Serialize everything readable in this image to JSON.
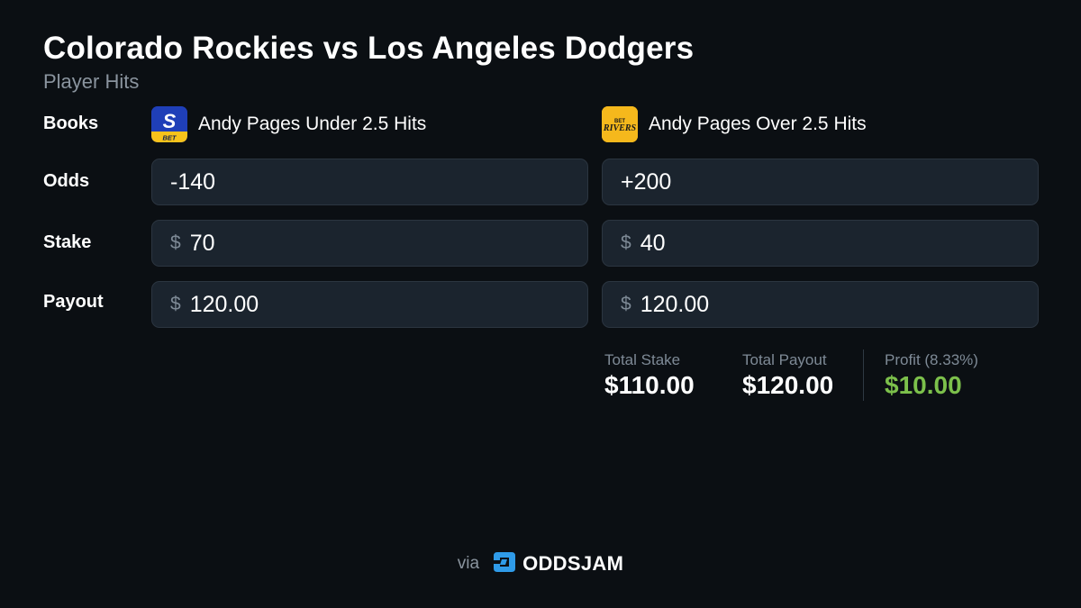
{
  "header": {
    "title": "Colorado Rockies vs Los Angeles Dodgers",
    "subtitle": "Player Hits"
  },
  "row_labels": {
    "books": "Books",
    "odds": "Odds",
    "stake": "Stake",
    "payout": "Payout"
  },
  "currency_symbol": "$",
  "bets": [
    {
      "book_logo": "thescore-bet-logo",
      "book_logo_text": "BET",
      "logo_letter": "S",
      "market": "Andy Pages Under 2.5 Hits",
      "odds": "-140",
      "stake": "70",
      "payout": "120.00"
    },
    {
      "book_logo": "betrivers-logo",
      "book_logo_text_top": "BET",
      "book_logo_text_bottom": "RIVERS",
      "market": "Andy Pages Over 2.5 Hits",
      "odds": "+200",
      "stake": "40",
      "payout": "120.00"
    }
  ],
  "summary": {
    "total_stake_label": "Total Stake",
    "total_stake": "$110.00",
    "total_payout_label": "Total Payout",
    "total_payout": "$120.00",
    "profit_label": "Profit (8.33%)",
    "profit": "$10.00"
  },
  "footer": {
    "via": "via",
    "brand": "ODDSJAM",
    "brand_icon": "oddsjam-logo-icon"
  },
  "colors": {
    "background": "#0b0f13",
    "field_background": "#1b242e",
    "profit_green": "#7cc04b",
    "muted_text": "#7e8a96",
    "brand_blue": "#2f9be8",
    "betrivers_gold": "#f5b81c",
    "thescore_blue": "#1f3fb8"
  }
}
